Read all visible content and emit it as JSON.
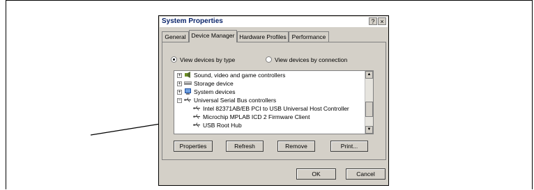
{
  "dialog": {
    "title": "System Properties",
    "help_button": "?",
    "close_button": "×"
  },
  "tabs": [
    {
      "label": "General"
    },
    {
      "label": "Device Manager"
    },
    {
      "label": "Hardware Profiles"
    },
    {
      "label": "Performance"
    }
  ],
  "view_options": {
    "by_type": "View devices by type",
    "by_connection": "View devices by connection",
    "selected": "by_type"
  },
  "device_list": {
    "items": [
      {
        "label": "Sound, video and game controllers",
        "level": 0,
        "expander": "+"
      },
      {
        "label": "Storage device",
        "level": 0,
        "expander": "+"
      },
      {
        "label": "System devices",
        "level": 0,
        "expander": "+"
      },
      {
        "label": "Universal Serial Bus controllers",
        "level": 0,
        "expander": "−"
      },
      {
        "label": "Intel 82371AB/EB PCI to USB Universal Host Controller",
        "level": 1
      },
      {
        "label": "Microchip MPLAB ICD 2 Firmware Client",
        "level": 1
      },
      {
        "label": "USB Root Hub",
        "level": 1
      }
    ]
  },
  "buttons": {
    "properties": "Properties",
    "refresh": "Refresh",
    "remove": "Remove",
    "print": "Print...",
    "ok": "OK",
    "cancel": "Cancel"
  }
}
